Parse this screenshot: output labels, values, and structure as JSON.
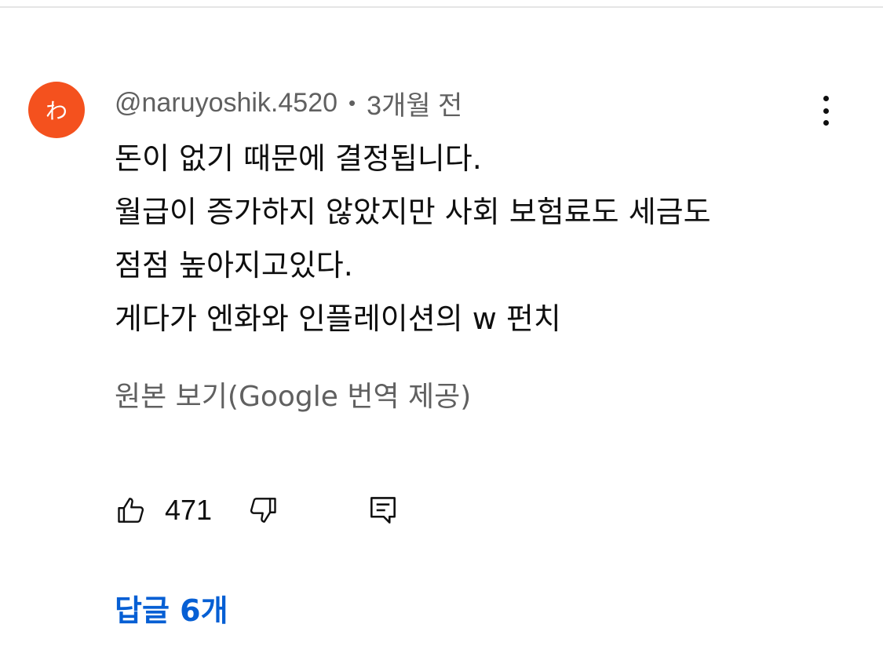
{
  "comment": {
    "avatar_letter": "わ",
    "avatar_color": "#f4511e",
    "author": "@naruyoshik.4520",
    "separator": "•",
    "time": "3개월 전",
    "body_lines": [
      "돈이 없기 때문에 결정됩니다.",
      "월급이 증가하지 않았지만 사회 보험료도 세금도",
      "점점 높아지고있다.",
      "게다가 엔화와 인플레이션의 w 펀치"
    ],
    "translate_label": "원본 보기(Google 번역 제공)",
    "like_count": "471",
    "replies_label": "답글 6개",
    "icons": {
      "like": "thumbs-up-icon",
      "dislike": "thumbs-down-icon",
      "reply": "comment-reply-icon",
      "more": "more-vertical-icon"
    },
    "colors": {
      "link_blue": "#065fd4",
      "meta_gray": "#606060",
      "text": "#0f0f0f"
    }
  }
}
